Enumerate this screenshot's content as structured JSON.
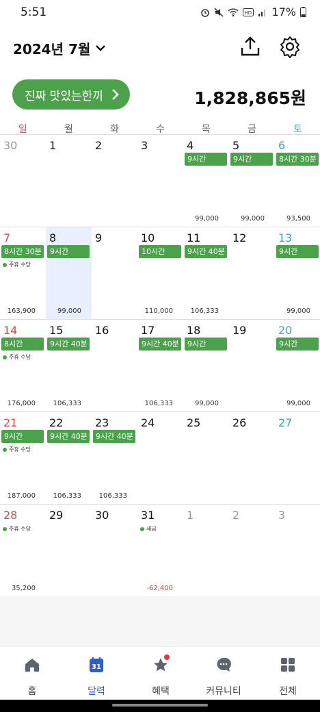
{
  "status": {
    "time": "5:51",
    "battery": "17%"
  },
  "header": {
    "month": "2024년 7월"
  },
  "hero": {
    "button_label": "진짜 맛있는한끼",
    "total": "1,828,865원"
  },
  "weekdays": [
    "일",
    "월",
    "화",
    "수",
    "목",
    "금",
    "토"
  ],
  "weeks": [
    [
      {
        "day": "30",
        "other": true
      },
      {
        "day": "1"
      },
      {
        "day": "2"
      },
      {
        "day": "3"
      },
      {
        "day": "4",
        "badge": "9시간",
        "amount": "99,000"
      },
      {
        "day": "5",
        "badge": "9시간",
        "amount": "99,000"
      },
      {
        "day": "6",
        "badge": "8시간 30분",
        "amount": "93,500"
      }
    ],
    [
      {
        "day": "7",
        "badge": "8시간 30분",
        "note": "주휴 수당",
        "amount": "163,900"
      },
      {
        "day": "8",
        "badge": "9시간",
        "amount": "99,000",
        "today": true
      },
      {
        "day": "9"
      },
      {
        "day": "10",
        "badge": "10시간",
        "amount": "110,000"
      },
      {
        "day": "11",
        "badge": "9시간 40분",
        "amount": "106,333"
      },
      {
        "day": "12"
      },
      {
        "day": "13",
        "badge": "9시간",
        "amount": "99,000"
      }
    ],
    [
      {
        "day": "14",
        "badge": "8시간",
        "note": "주휴 수당",
        "amount": "176,000"
      },
      {
        "day": "15",
        "badge": "9시간 40분",
        "amount": "106,333"
      },
      {
        "day": "16"
      },
      {
        "day": "17",
        "badge": "9시간 40분",
        "amount": "106,333"
      },
      {
        "day": "18",
        "badge": "9시간",
        "amount": "99,000"
      },
      {
        "day": "19"
      },
      {
        "day": "20",
        "badge": "9시간",
        "amount": "99,000"
      }
    ],
    [
      {
        "day": "21",
        "badge": "9시간",
        "note": "주휴 수당",
        "amount": "187,000"
      },
      {
        "day": "22",
        "badge": "9시간 40분",
        "amount": "106,333"
      },
      {
        "day": "23",
        "badge": "9시간 40분",
        "amount": "106,333"
      },
      {
        "day": "24"
      },
      {
        "day": "25"
      },
      {
        "day": "26"
      },
      {
        "day": "27"
      }
    ],
    [
      {
        "day": "28",
        "note": "주휴 수당",
        "amount": "35,200"
      },
      {
        "day": "29"
      },
      {
        "day": "30"
      },
      {
        "day": "31",
        "note": "세금",
        "amount": "-62,400",
        "negative": true
      },
      {
        "day": "1",
        "other": true
      },
      {
        "day": "2",
        "other": true
      },
      {
        "day": "3",
        "other": true
      }
    ]
  ],
  "nav": [
    {
      "label": "홈",
      "icon": "home-icon"
    },
    {
      "label": "달력",
      "icon": "calendar-icon",
      "active": true,
      "calendar_day": "31"
    },
    {
      "label": "혜택",
      "icon": "star-icon"
    },
    {
      "label": "커뮤니티",
      "icon": "chat-icon"
    },
    {
      "label": "전체",
      "icon": "grid-icon"
    }
  ],
  "colors": {
    "accent_green": "#4ba24a",
    "sunday": "#d94a4a",
    "saturday": "#3fa2c7",
    "active_nav": "#2f5ec7",
    "negative": "#e53935"
  }
}
